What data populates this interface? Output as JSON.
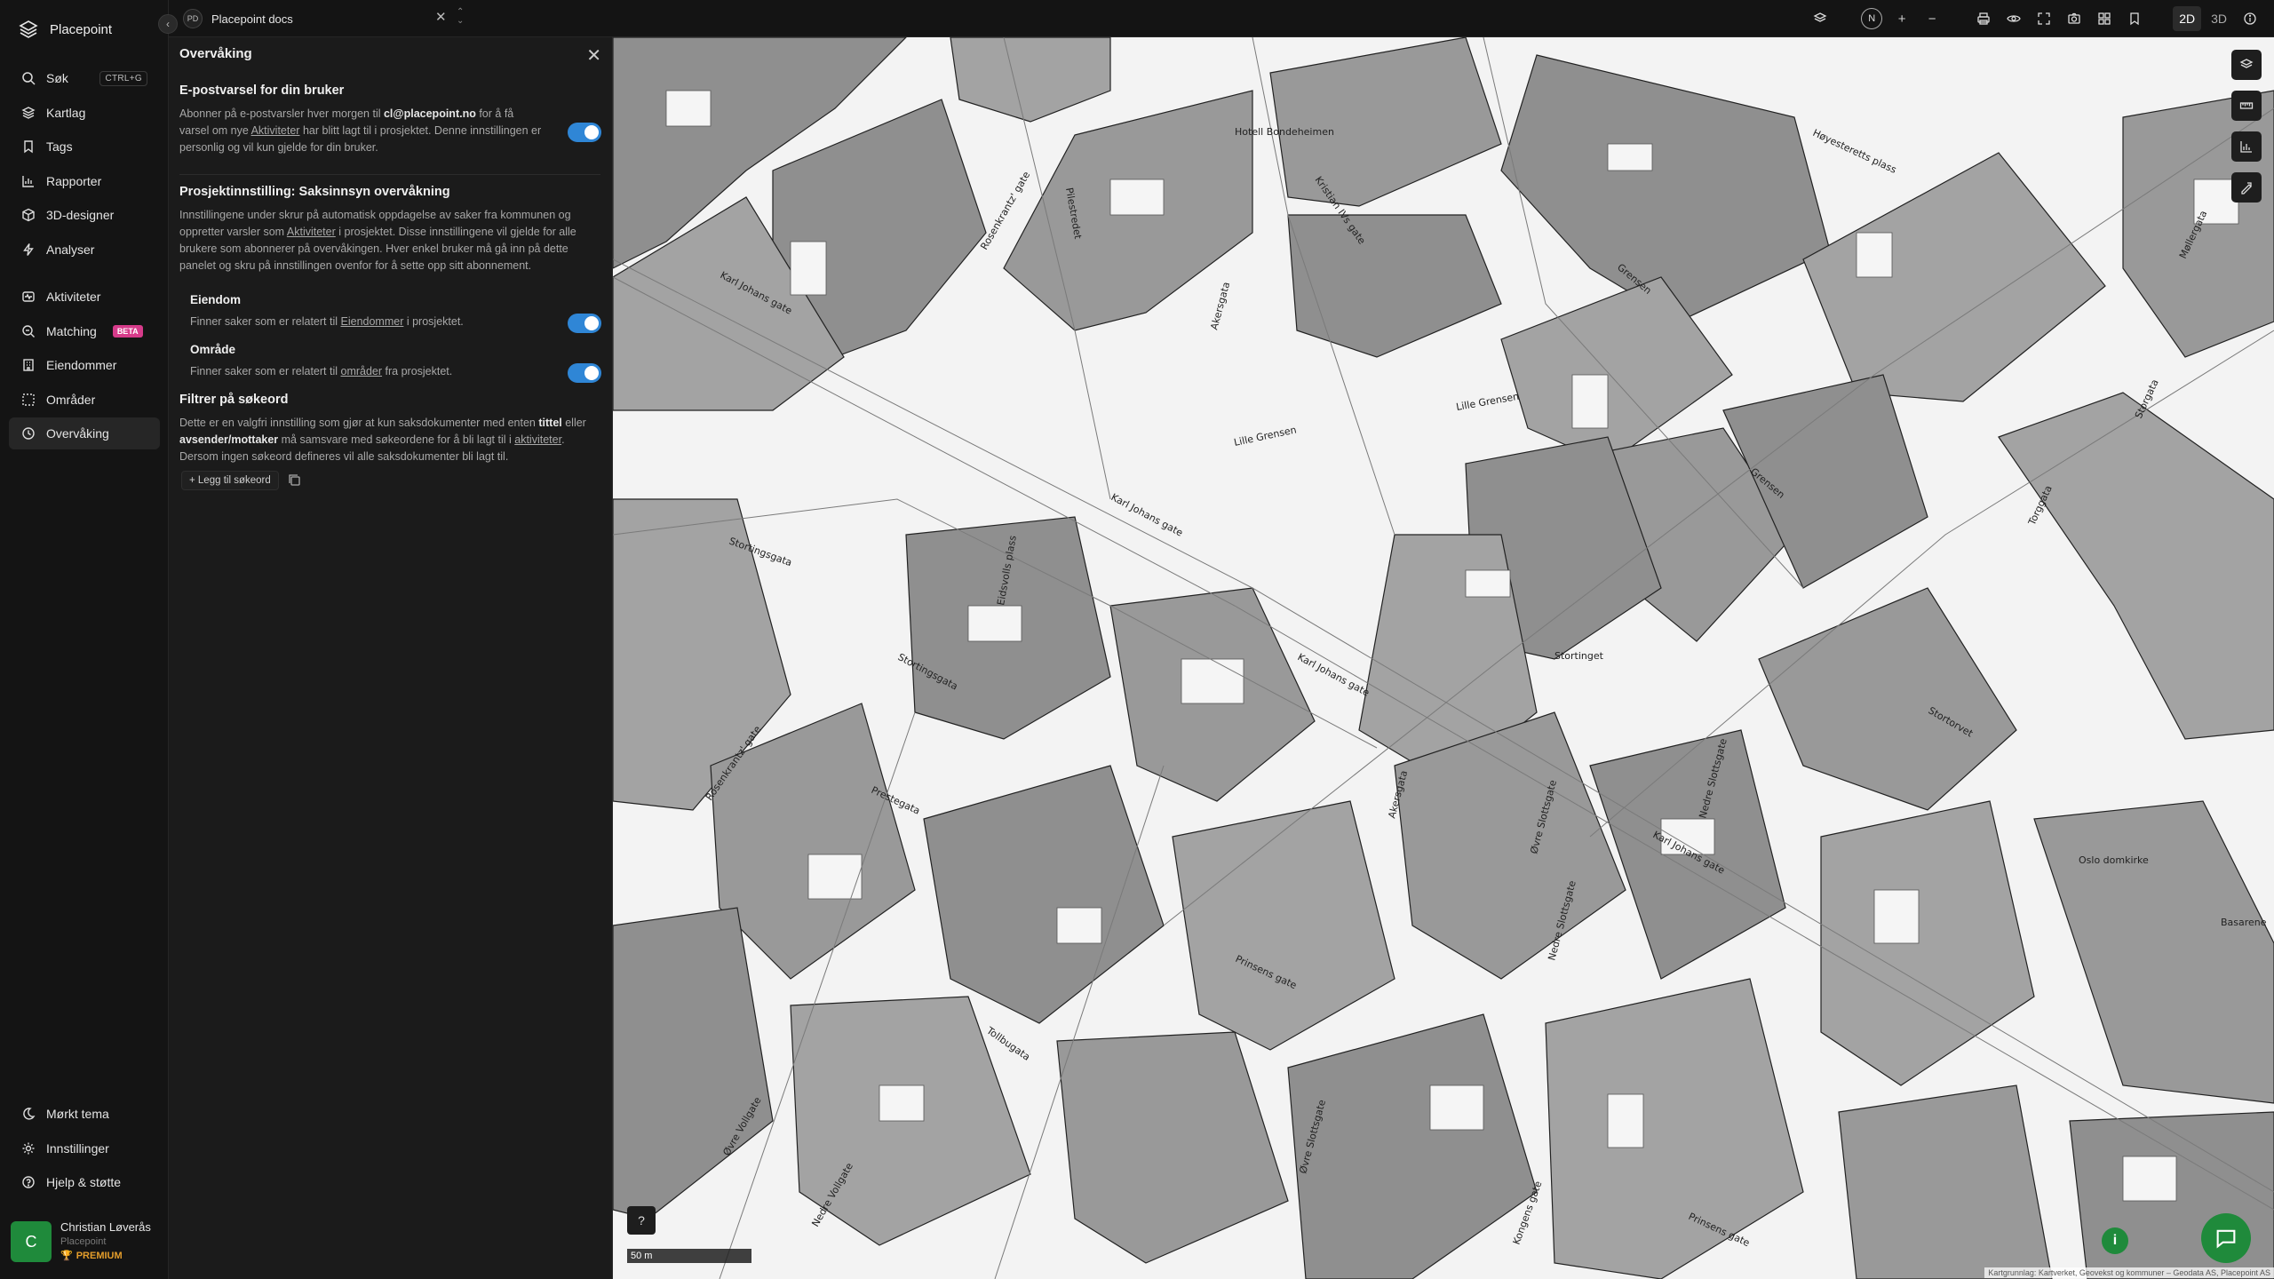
{
  "app": {
    "name": "Placepoint"
  },
  "nav_main": [
    {
      "label": "Søk",
      "icon": "search-icon",
      "shortcut": "CTRL+G"
    },
    {
      "label": "Kartlag",
      "icon": "layers-icon"
    },
    {
      "label": "Tags",
      "icon": "bookmark-icon"
    },
    {
      "label": "Rapporter",
      "icon": "chart-icon"
    },
    {
      "label": "3D-designer",
      "icon": "cube-icon"
    },
    {
      "label": "Analyser",
      "icon": "bolt-icon"
    }
  ],
  "nav_second": [
    {
      "label": "Aktiviteter",
      "icon": "activity-icon"
    },
    {
      "label": "Matching",
      "icon": "target-icon",
      "badge": "BETA"
    },
    {
      "label": "Eiendommer",
      "icon": "building-icon"
    },
    {
      "label": "Områder",
      "icon": "area-icon"
    },
    {
      "label": "Overvåking",
      "icon": "monitor-icon",
      "active": true
    }
  ],
  "nav_bottom": [
    {
      "label": "Mørkt tema",
      "icon": "moon-icon"
    },
    {
      "label": "Innstillinger",
      "icon": "gear-icon"
    },
    {
      "label": "Hjelp & støtte",
      "icon": "help-icon"
    }
  ],
  "user": {
    "initial": "C",
    "name": "Christian Løverås",
    "org": "Placepoint",
    "plan": "PREMIUM"
  },
  "topbar": {
    "project_initials": "PD",
    "project_name": "Placepoint docs",
    "north": "N",
    "mode_2d": "2D",
    "mode_3d": "3D"
  },
  "panel": {
    "title": "Overvåking",
    "email_section": {
      "heading": "E-postvarsel for din bruker",
      "text_1": "Abonner på e-postvarsler hver morgen til ",
      "email": "cl@placepoint.no",
      "text_2": " for å få varsel om nye ",
      "link": "Aktiviteter",
      "text_3": " har blitt lagt til i prosjektet. Denne innstillingen er personlig og vil kun gjelde for din bruker.",
      "enabled": true
    },
    "project_section": {
      "heading": "Prosjektinnstilling: Saksinnsyn overvåkning",
      "text_1": "Innstillingene under skrur på automatisk oppdagelse av saker fra kommunen og oppretter varsler som ",
      "link": "Aktiviteter",
      "text_2": " i prosjektet. Disse innstillingene vil gjelde for alle brukere som abonnerer på overvåkingen. Hver enkel bruker må gå inn på dette panelet og skru på innstillingen ovenfor for å sette opp sitt abonnement.",
      "eiendom": {
        "label": "Eiendom",
        "text_1": "Finner saker som er relatert til ",
        "link": "Eiendommer",
        "text_2": " i prosjektet.",
        "enabled": true
      },
      "omrade": {
        "label": "Område",
        "text_1": "Finner saker som er relatert til ",
        "link": "områder",
        "text_2": " fra prosjektet.",
        "enabled": true
      }
    },
    "filter_section": {
      "heading": "Filtrer på søkeord",
      "text_1": "Dette er en valgfri innstilling som gjør at kun saksdokumenter med enten ",
      "bold_1": "tittel",
      "text_2": " eller ",
      "bold_2": "avsender/mottaker",
      "text_3": " må samsvare med søkeordene for å bli lagt til i ",
      "link": "aktiviteter",
      "text_4": ". Dersom ingen søkeord defineres vil alle saksdokumenter bli lagt til.",
      "add_button": "+ Legg til søkeord"
    }
  },
  "map": {
    "scale_label": "50 m",
    "attribution": "Kartgrunnlag: Kartverket, Geovekst og kommuner – Geodata AS, Placepoint AS",
    "place_labels": [
      "Karl Johans gate",
      "Karl Johans gate",
      "Karl Johans gate",
      "Karl Johans gate",
      "Stortinget",
      "Lille Grensen",
      "Lille Grensen",
      "Grensen",
      "Grensen",
      "Akersgata",
      "Akersgata",
      "Øvre Slottsgate",
      "Øvre Slottsgate",
      "Nedre Slottsgate",
      "Nedre Slottsgate",
      "Prinsens gate",
      "Prinsens gate",
      "Tollbugata",
      "Stortingsgata",
      "Stortingsgata",
      "Rosenkrantz' gate",
      "Rosenkrantz' gate",
      "Eidsvolls plass",
      "Oslo domkirke",
      "Stortorvet",
      "Hotell Bondeheimen",
      "Kristian IVs gate",
      "Pilestredet",
      "Møllergata",
      "Torggata",
      "Storgata",
      "Kongens gate",
      "Øvre Vollgate",
      "Nedre Vollgate",
      "Prestegata",
      "Basarene",
      "Høyesteretts plass"
    ]
  }
}
